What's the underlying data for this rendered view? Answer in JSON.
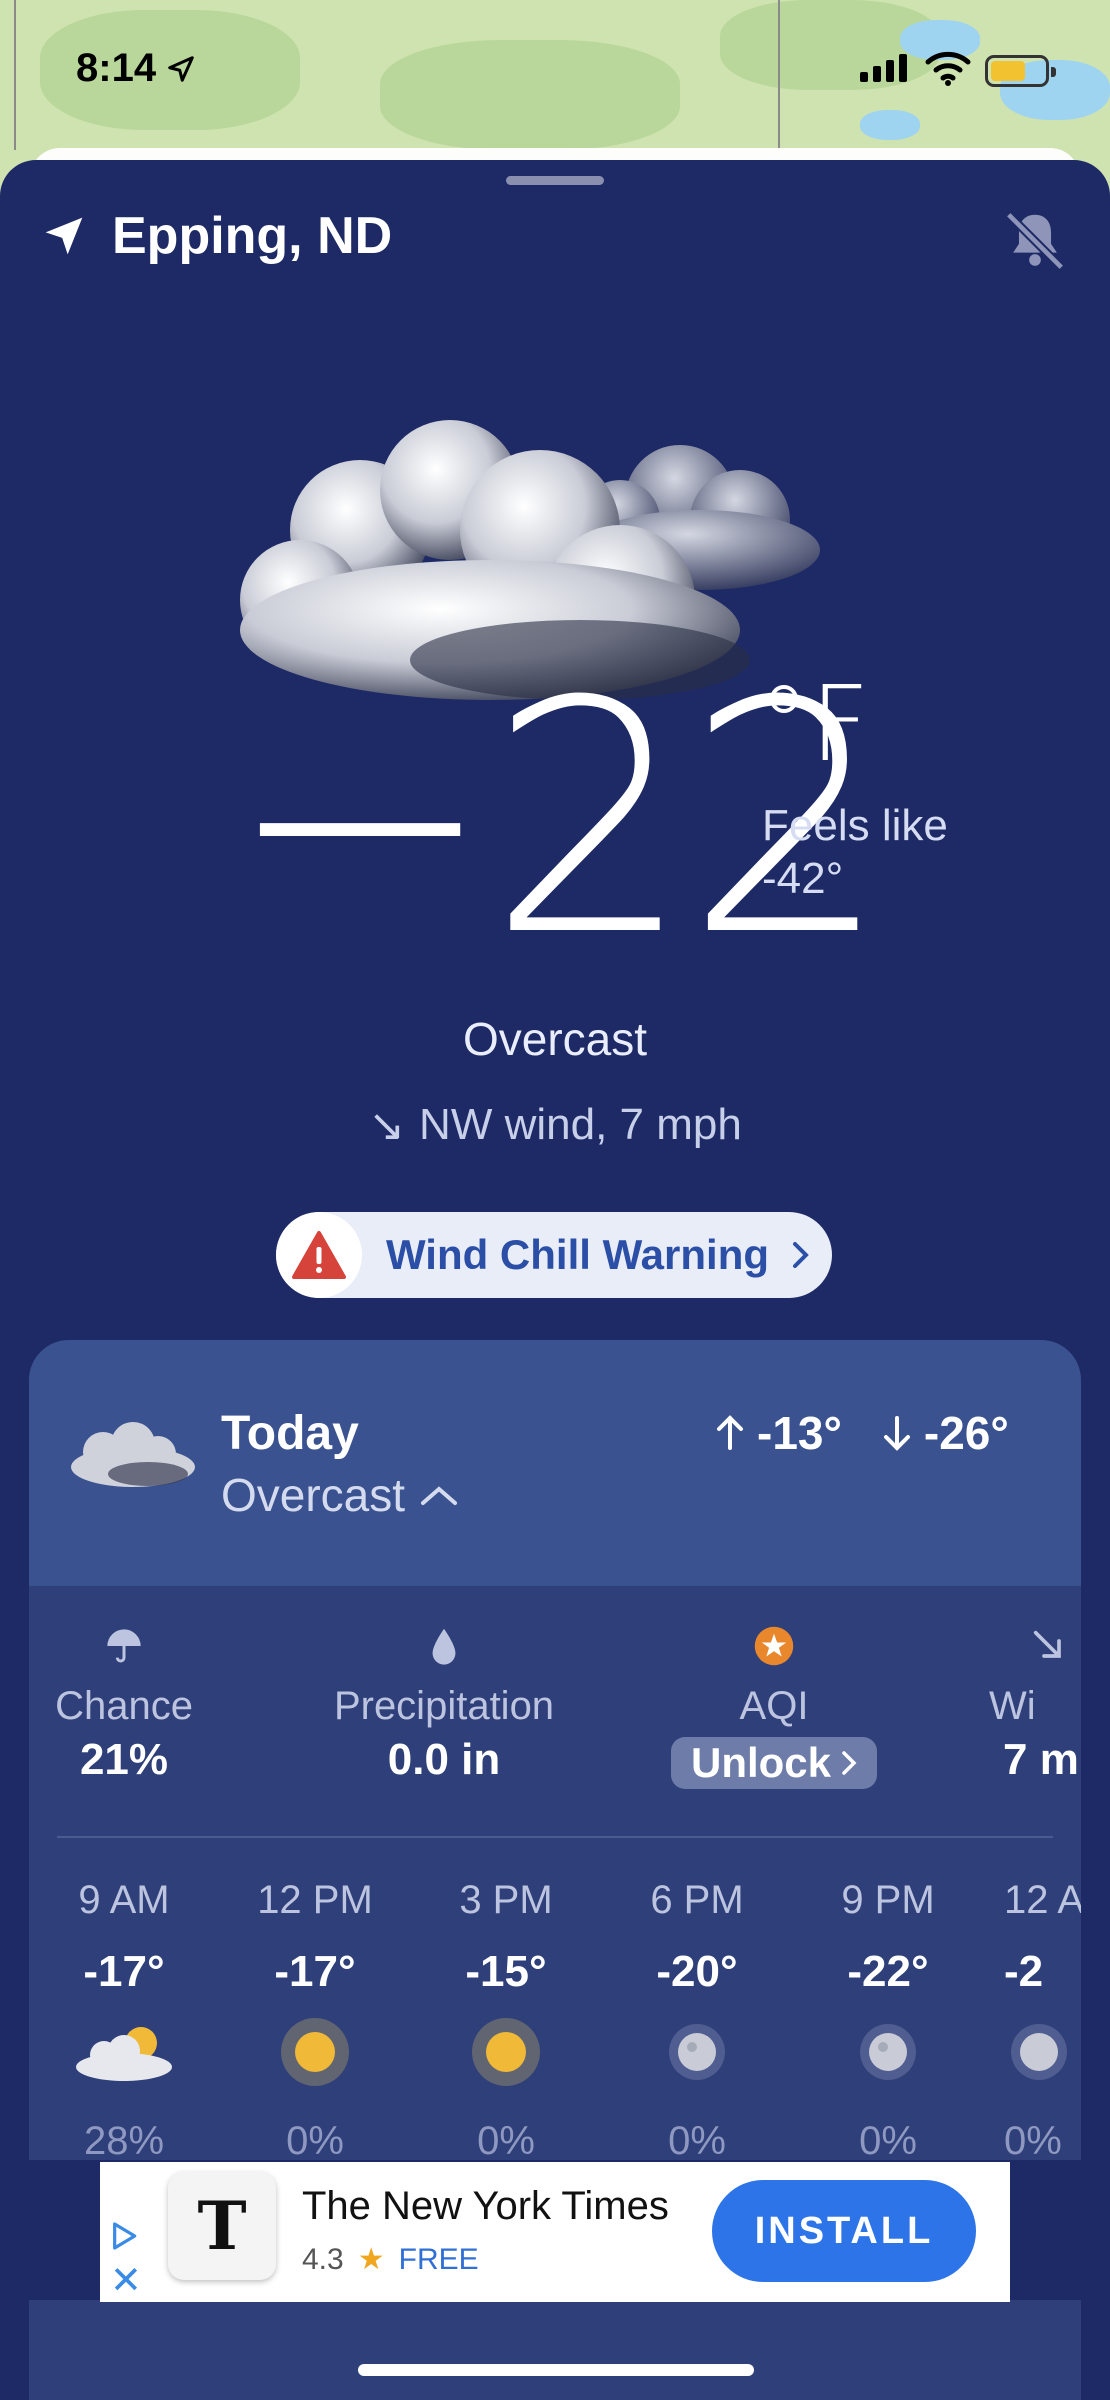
{
  "status_bar": {
    "time": "8:14"
  },
  "location": {
    "name": "Epping, ND"
  },
  "current": {
    "temperature": "−22",
    "unit": "°F",
    "feels_like_label": "Feels like",
    "feels_like_value": "-42°",
    "condition": "Overcast",
    "wind_arrow": "↘",
    "wind": "NW wind, 7 mph"
  },
  "alert": {
    "label": "Wind Chill Warning"
  },
  "today": {
    "title": "Today",
    "condition": "Overcast",
    "high": "-13°",
    "low": "-26°",
    "metrics": [
      {
        "icon": "umbrella-icon",
        "label": "Chance",
        "value": "21%"
      },
      {
        "icon": "droplet-icon",
        "label": "Precipitation",
        "value": "0.0 in"
      },
      {
        "icon": "star-badge-icon",
        "label": "AQI",
        "value": "Unlock"
      },
      {
        "icon": "wind-icon",
        "label": "Wi",
        "value": "7 m"
      }
    ],
    "hourly": [
      {
        "time": "9 AM",
        "temp": "-17°",
        "icon": "partly-cloudy-icon",
        "precip": "28%"
      },
      {
        "time": "12 PM",
        "temp": "-17°",
        "icon": "sun-icon",
        "precip": "0%"
      },
      {
        "time": "3 PM",
        "temp": "-15°",
        "icon": "sun-icon",
        "precip": "0%"
      },
      {
        "time": "6 PM",
        "temp": "-20°",
        "icon": "moon-icon",
        "precip": "0%"
      },
      {
        "time": "9 PM",
        "temp": "-22°",
        "icon": "moon-icon",
        "precip": "0%"
      },
      {
        "time": "12 A",
        "temp": "-2",
        "icon": "moon-icon",
        "precip": "0%"
      }
    ]
  },
  "ad": {
    "title": "The New York Times",
    "rating": "4.3",
    "price": "FREE",
    "install_label": "INSTALL",
    "logo_letter": "T"
  },
  "colors": {
    "background": "#1d2a66",
    "card": "#2e3f79",
    "card_header": "#3a5290",
    "accent": "#2d74e8",
    "alert_text": "#2b4ea6"
  }
}
